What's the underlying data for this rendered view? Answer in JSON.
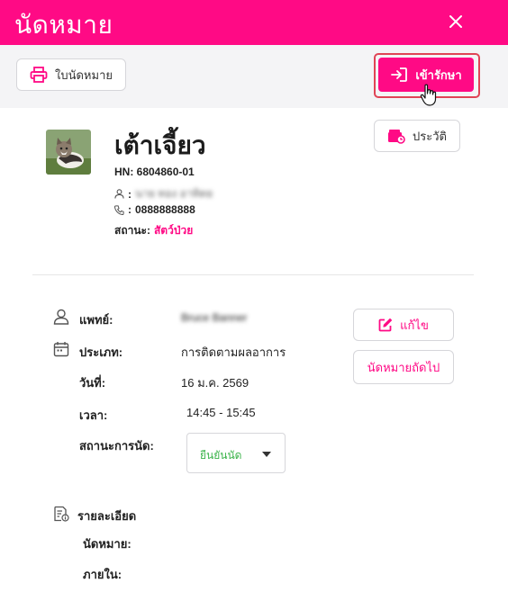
{
  "header": {
    "title": "นัดหมาย"
  },
  "toolbar": {
    "print_label": "ใบนัดหมาย",
    "admit_label": "เข้ารักษา"
  },
  "pet": {
    "name": "เต้าเจี้ยว",
    "hn": "HN: 6804860-01",
    "owner": "นาย ทอง อาทิตย",
    "phone": "0888888888",
    "status_label": "สถานะ:",
    "status_value": "สัตว์ป่วย",
    "history_label": "ประวัติ"
  },
  "appointment": {
    "doctor_label": "แพทย์:",
    "doctor_value": "Bruce Banner",
    "type_label": "ประเภท:",
    "type_value": "การติดตามผลอาการ",
    "date_label": "วันที่:",
    "date_value": "16 ม.ค. 2569",
    "time_label": "เวลา:",
    "time_value": "14:45 - 15:45",
    "status_label": "สถานะการนัด:",
    "status_value": "ยืนยันนัด",
    "edit_label": "แก้ไข",
    "next_label": "นัดหมายถัดไป"
  },
  "details": {
    "heading": "รายละเอียด",
    "appointment_label": "นัดหมาย:",
    "internal_label": "ภายใน:"
  },
  "colors": {
    "brand": "#ff0a85",
    "confirmed": "#3bb34a"
  }
}
